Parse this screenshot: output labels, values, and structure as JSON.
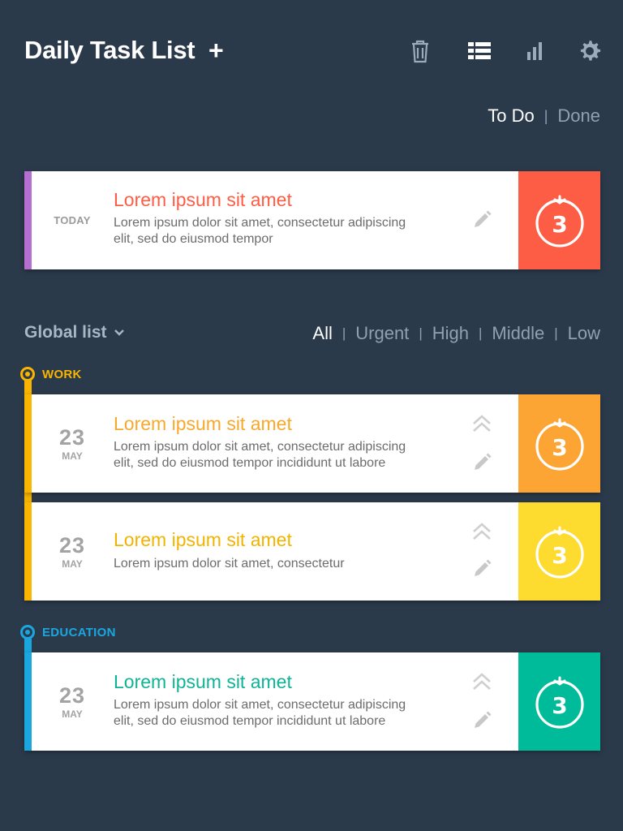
{
  "header": {
    "title": "Daily Task List",
    "add_label": "+",
    "icons": [
      "trash-icon",
      "list-view-icon",
      "bar-chart-icon",
      "gear-icon"
    ]
  },
  "status_tabs": {
    "todo": "To Do",
    "done": "Done",
    "separator": "|",
    "active": "todo"
  },
  "today_card": {
    "date_label": "TODAY",
    "title": "Lorem ipsum sit amet",
    "desc_line1": "Lorem ipsum dolor sit amet, consectetur adipiscing",
    "desc_line2": "elit, sed do eiusmod tempor",
    "pomodoro_count": "3",
    "stripe_color": "#b46fd0",
    "accent_color": "#fd5d45"
  },
  "list_header": {
    "dropdown_label": "Global list",
    "filters": [
      "All",
      "Urgent",
      "High",
      "Middle",
      "Low"
    ],
    "active_filter": "All",
    "separator": "|"
  },
  "categories": [
    {
      "label": "WORK",
      "color": "#f9b500",
      "tasks": [
        {
          "day": "23",
          "month": "MAY",
          "title": "Lorem ipsum sit amet",
          "desc_line1": "Lorem ipsum dolor sit amet, consectetur adipiscing",
          "desc_line2": "elit, sed do eiusmod tempor incididunt ut labore",
          "pomodoro_count": "3",
          "accent_color": "#fda534"
        },
        {
          "day": "23",
          "month": "MAY",
          "title": "Lorem ipsum sit amet",
          "desc_line1": "Lorem ipsum dolor sit amet, consectetur",
          "desc_line2": "",
          "pomodoro_count": "3",
          "accent_color": "#fddb2f"
        }
      ]
    },
    {
      "label": "EDUCATION",
      "color": "#1aa7e0",
      "tasks": [
        {
          "day": "23",
          "month": "MAY",
          "title": "Lorem ipsum sit amet",
          "desc_line1": "Lorem ipsum dolor sit amet, consectetur adipiscing",
          "desc_line2": "elit, sed do eiusmod tempor incididunt ut labore",
          "pomodoro_count": "3",
          "accent_color": "#00bb9a"
        }
      ]
    }
  ],
  "colors": {
    "background": "#2b3a4b",
    "muted_text": "#8fa0b1",
    "title_orange": "#f6a92c",
    "title_yellow": "#f0b400",
    "title_teal": "#10b396"
  }
}
